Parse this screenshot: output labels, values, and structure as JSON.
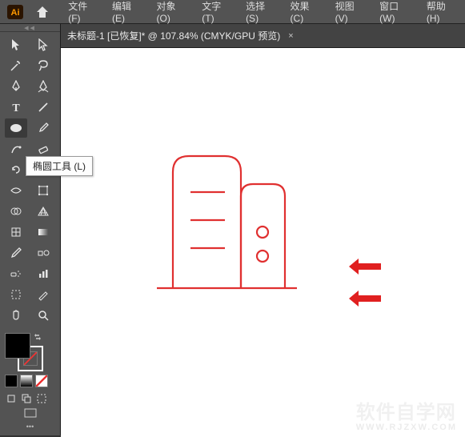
{
  "menubar": {
    "items": [
      {
        "label": "文件(F)"
      },
      {
        "label": "编辑(E)"
      },
      {
        "label": "对象(O)"
      },
      {
        "label": "文字(T)"
      },
      {
        "label": "选择(S)"
      },
      {
        "label": "效果(C)"
      },
      {
        "label": "视图(V)"
      },
      {
        "label": "窗口(W)"
      },
      {
        "label": "帮助(H)"
      }
    ]
  },
  "document_tab": {
    "title": "未标题-1 [已恢复]* @ 107.84% (CMYK/GPU 预览)",
    "close_glyph": "×"
  },
  "tooltip": {
    "text": "椭圆工具 (L)"
  },
  "tools": {
    "row0": [
      "selection",
      "direct-selection"
    ],
    "row1": [
      "magic-wand",
      "lasso"
    ],
    "row2": [
      "pen",
      "curvature"
    ],
    "row3": [
      "type",
      "line-segment"
    ],
    "row4": [
      "ellipse",
      "paintbrush"
    ],
    "row5": [
      "shaper",
      "eraser"
    ],
    "row6": [
      "rotate",
      "scale"
    ],
    "row7": [
      "width",
      "free-transform"
    ],
    "row8": [
      "shape-builder",
      "perspective-grid"
    ],
    "row9": [
      "mesh",
      "gradient"
    ],
    "row10": [
      "eyedropper",
      "blend"
    ],
    "row11": [
      "symbol-sprayer",
      "column-graph"
    ],
    "row12": [
      "artboard",
      "slice"
    ],
    "row13": [
      "hand",
      "zoom"
    ]
  },
  "selected_tool": "ellipse",
  "watermark": {
    "main": "软件自学网",
    "sub": "WWW.RJZXW.COM"
  },
  "colors": {
    "artwork_stroke": "#e03030",
    "arrow_fill": "#e02020"
  }
}
